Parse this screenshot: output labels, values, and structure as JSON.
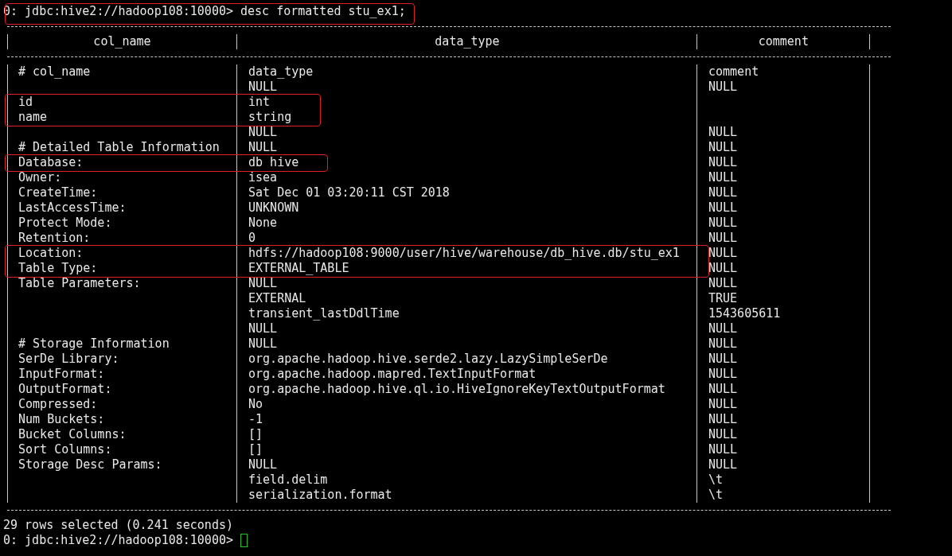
{
  "command_line": {
    "prompt": "0: jdbc:hive2://hadoop108:10000>",
    "command": "desc formatted stu_ex1;",
    "highlighted": true
  },
  "table": {
    "columns": [
      "col_name",
      "data_type",
      "comment"
    ],
    "rows": [
      {
        "cells": [
          "# col_name",
          "data_type",
          "comment"
        ],
        "highlighted": false
      },
      {
        "cells": [
          null,
          "NULL",
          "NULL"
        ],
        "highlighted": false
      },
      {
        "cells": [
          "id",
          "int",
          null
        ],
        "highlighted": true
      },
      {
        "cells": [
          "name",
          "string",
          null
        ],
        "highlighted": true
      },
      {
        "cells": [
          null,
          "NULL",
          "NULL"
        ],
        "highlighted": false
      },
      {
        "cells": [
          "# Detailed Table Information",
          "NULL",
          "NULL"
        ],
        "highlighted": false
      },
      {
        "cells": [
          "Database:",
          "db hive",
          "NULL"
        ],
        "highlighted": true
      },
      {
        "cells": [
          "Owner:",
          "isea",
          "NULL"
        ],
        "highlighted": false
      },
      {
        "cells": [
          "CreateTime:",
          "Sat Dec 01 03:20:11 CST 2018",
          "NULL"
        ],
        "highlighted": false
      },
      {
        "cells": [
          "LastAccessTime:",
          "UNKNOWN",
          "NULL"
        ],
        "highlighted": false
      },
      {
        "cells": [
          "Protect Mode:",
          "None",
          "NULL"
        ],
        "highlighted": false
      },
      {
        "cells": [
          "Retention:",
          "0",
          "NULL"
        ],
        "highlighted": false
      },
      {
        "cells": [
          "Location:",
          "hdfs://hadoop108:9000/user/hive/warehouse/db_hive.db/stu_ex1",
          "NULL"
        ],
        "highlighted": true
      },
      {
        "cells": [
          "Table Type:",
          "EXTERNAL_TABLE",
          "NULL"
        ],
        "highlighted": true
      },
      {
        "cells": [
          "Table Parameters:",
          "NULL",
          "NULL"
        ],
        "highlighted": false
      },
      {
        "cells": [
          null,
          "EXTERNAL",
          "TRUE"
        ],
        "highlighted": false
      },
      {
        "cells": [
          null,
          "transient_lastDdlTime",
          "1543605611"
        ],
        "highlighted": false
      },
      {
        "cells": [
          null,
          "NULL",
          "NULL"
        ],
        "highlighted": false
      },
      {
        "cells": [
          "# Storage Information",
          "NULL",
          "NULL"
        ],
        "highlighted": false
      },
      {
        "cells": [
          "SerDe Library:",
          "org.apache.hadoop.hive.serde2.lazy.LazySimpleSerDe",
          "NULL"
        ],
        "highlighted": false
      },
      {
        "cells": [
          "InputFormat:",
          "org.apache.hadoop.mapred.TextInputFormat",
          "NULL"
        ],
        "highlighted": false
      },
      {
        "cells": [
          "OutputFormat:",
          "org.apache.hadoop.hive.ql.io.HiveIgnoreKeyTextOutputFormat",
          "NULL"
        ],
        "highlighted": false
      },
      {
        "cells": [
          "Compressed:",
          "No",
          "NULL"
        ],
        "highlighted": false
      },
      {
        "cells": [
          "Num Buckets:",
          "-1",
          "NULL"
        ],
        "highlighted": false
      },
      {
        "cells": [
          "Bucket Columns:",
          "[]",
          "NULL"
        ],
        "highlighted": false
      },
      {
        "cells": [
          "Sort Columns:",
          "[]",
          "NULL"
        ],
        "highlighted": false
      },
      {
        "cells": [
          "Storage Desc Params:",
          "NULL",
          "NULL"
        ],
        "highlighted": false
      },
      {
        "cells": [
          null,
          "field.delim",
          "\\t"
        ],
        "highlighted": false
      },
      {
        "cells": [
          null,
          "serialization.format",
          "\\t"
        ],
        "highlighted": false
      }
    ]
  },
  "status": "29 rows selected (0.241 seconds)",
  "prompt_line": {
    "prompt": "0: jdbc:hive2://hadoop108:10000>",
    "cursor": true
  }
}
